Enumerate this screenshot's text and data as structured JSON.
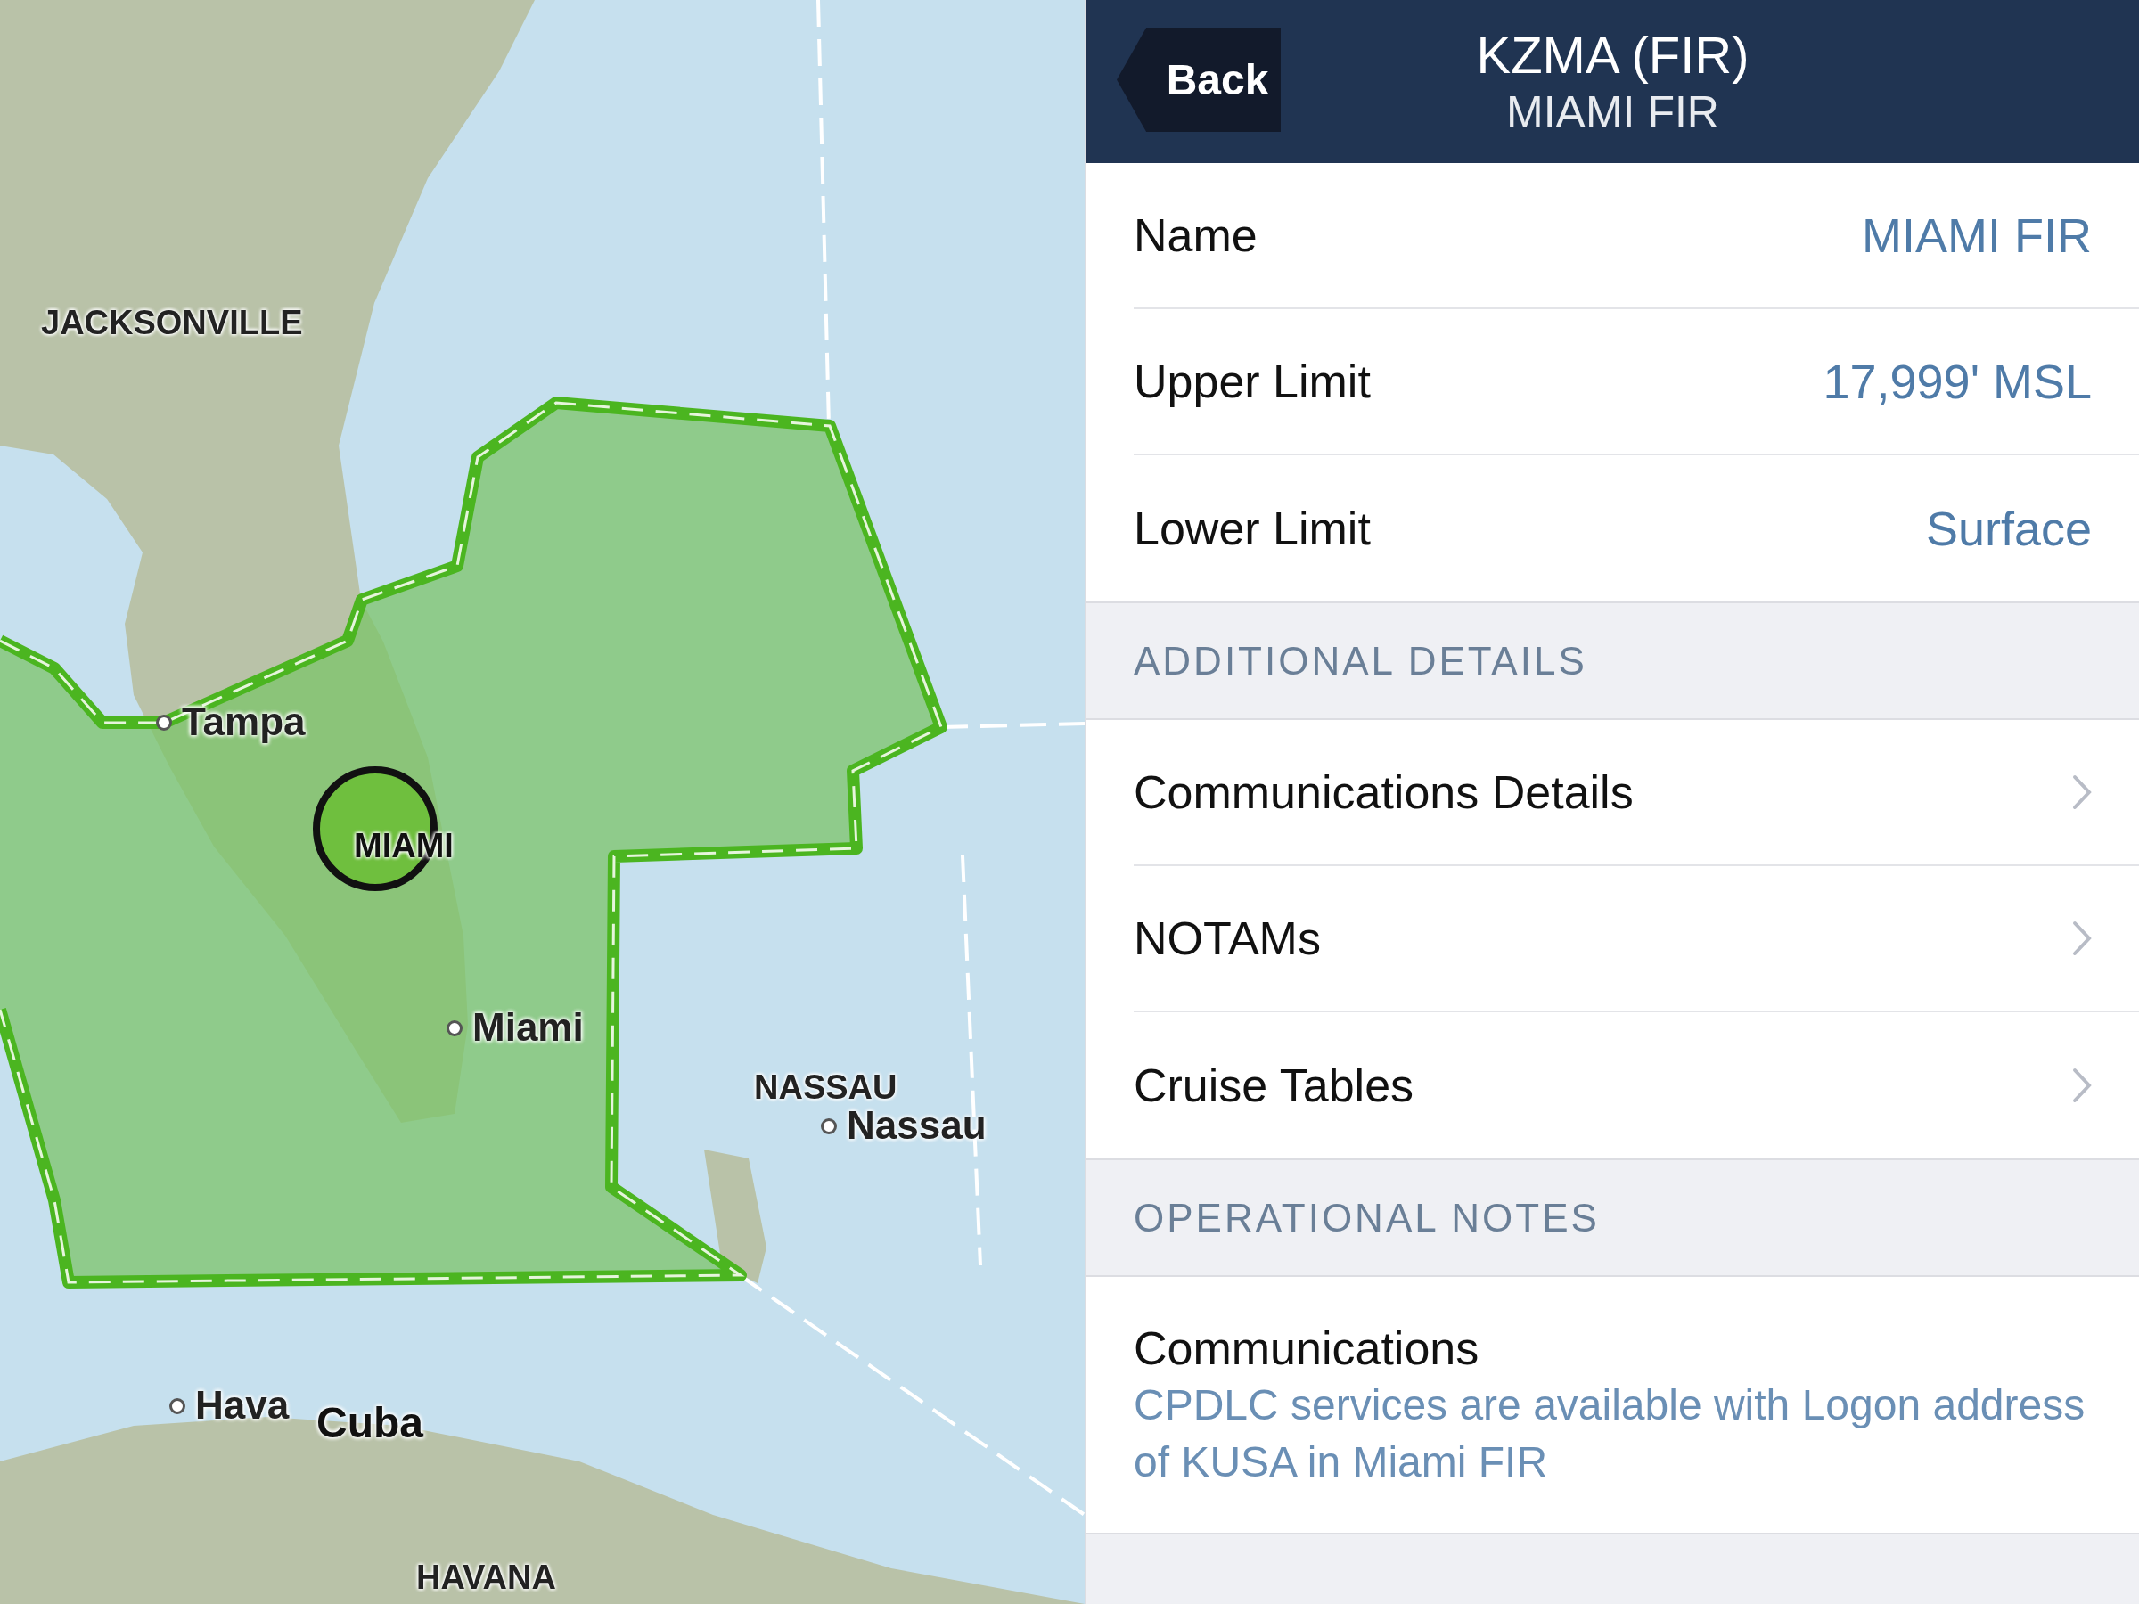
{
  "map": {
    "labels": [
      {
        "text": "JACKSONVILLE",
        "kind": "region"
      },
      {
        "text": "Tampa",
        "kind": "city"
      },
      {
        "text": "MIAMI",
        "kind": "airspace"
      },
      {
        "text": "Miami",
        "kind": "city"
      },
      {
        "text": "NASSAU",
        "kind": "region"
      },
      {
        "text": "Nassau",
        "kind": "city"
      },
      {
        "text": "Hava",
        "kind": "city"
      },
      {
        "text": "Cuba",
        "kind": "country"
      },
      {
        "text": "HAVANA",
        "kind": "region"
      }
    ]
  },
  "header": {
    "back": "Back",
    "title": "KZMA (FIR)",
    "subtitle": "MIAMI FIR"
  },
  "sections": [
    {
      "rows": [
        {
          "kind": "value",
          "label": "Name",
          "value": "MIAMI FIR"
        },
        {
          "kind": "value",
          "label": "Upper Limit",
          "value": "17,999' MSL"
        },
        {
          "kind": "value",
          "label": "Lower Limit",
          "value": "Surface"
        }
      ]
    },
    {
      "title": "ADDITIONAL DETAILS",
      "rows": [
        {
          "kind": "link",
          "label": "Communications Details"
        },
        {
          "kind": "link",
          "label": "NOTAMs"
        },
        {
          "kind": "link",
          "label": "Cruise Tables"
        }
      ]
    },
    {
      "title": "OPERATIONAL NOTES",
      "rows": [
        {
          "kind": "note",
          "label": "Communications",
          "value": "CPDLC services are available with Logon address of KUSA in Miami FIR"
        }
      ]
    }
  ]
}
